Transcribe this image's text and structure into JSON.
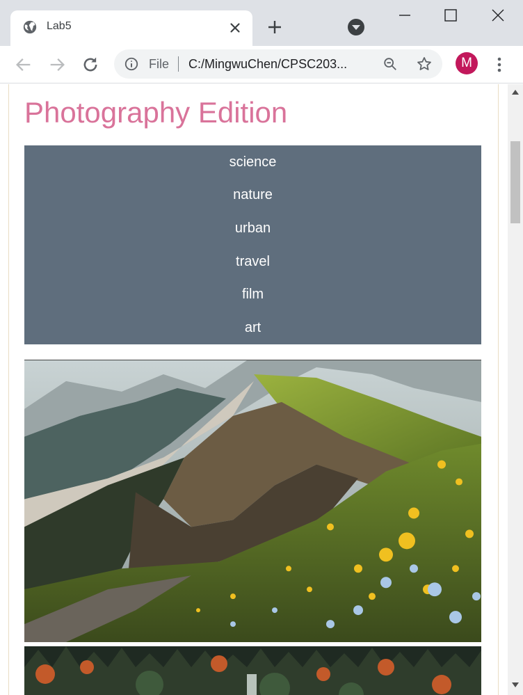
{
  "browser": {
    "tab": {
      "title": "Lab5"
    },
    "address": {
      "scheme_label": "File",
      "url": "C:/MingwuChen/CPSC203..."
    },
    "profile": {
      "initial": "M",
      "color": "#c2185b"
    }
  },
  "page": {
    "title": "Photography Edition",
    "title_color": "#d9739a",
    "nav": {
      "background": "#5f6e7d",
      "items": [
        {
          "label": "science"
        },
        {
          "label": "nature"
        },
        {
          "label": "urban"
        },
        {
          "label": "travel"
        },
        {
          "label": "film"
        },
        {
          "label": "art"
        }
      ]
    },
    "images": [
      {
        "name": "mountain-flowers-photo"
      },
      {
        "name": "forest-waterfall-photo"
      }
    ]
  }
}
